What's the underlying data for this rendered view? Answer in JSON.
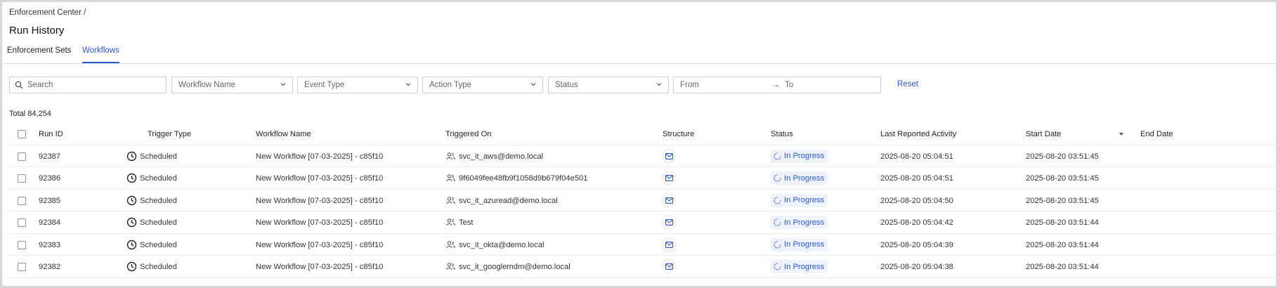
{
  "breadcrumb": "Enforcement Center /",
  "page_title": "Run History",
  "tabs": [
    {
      "label": "Enforcement Sets",
      "active": false
    },
    {
      "label": "Workflows",
      "active": true
    }
  ],
  "filters": {
    "search_placeholder": "Search",
    "workflow_name": "Workflow Name",
    "event_type": "Event Type",
    "action_type": "Action Type",
    "status": "Status",
    "from": "From",
    "to": "To",
    "reset": "Reset"
  },
  "total": "Total 84,254",
  "columns": [
    "Run ID",
    "Trigger Type",
    "Workflow Name",
    "Triggered On",
    "Structure",
    "Status",
    "Last Reported Activity",
    "Start Date",
    "End Date"
  ],
  "rows": [
    {
      "run_id": "92387",
      "trigger": "Scheduled",
      "workflow": "New Workflow [07-03-2025] - c85f10",
      "triggered_on": "svc_it_aws@demo.local",
      "status": "In Progress",
      "last_activity": "2025-08-20 05:04:51",
      "start_date": "2025-08-20 03:51:45",
      "end_date": ""
    },
    {
      "run_id": "92386",
      "trigger": "Scheduled",
      "workflow": "New Workflow [07-03-2025] - c85f10",
      "triggered_on": "9f6049fee48fb9f1058d9b679f04e501",
      "status": "In Progress",
      "last_activity": "2025-08-20 05:04:51",
      "start_date": "2025-08-20 03:51:45",
      "end_date": ""
    },
    {
      "run_id": "92385",
      "trigger": "Scheduled",
      "workflow": "New Workflow [07-03-2025] - c85f10",
      "triggered_on": "svc_it_azuread@demo.local",
      "status": "In Progress",
      "last_activity": "2025-08-20 05:04:50",
      "start_date": "2025-08-20 03:51:45",
      "end_date": ""
    },
    {
      "run_id": "92384",
      "trigger": "Scheduled",
      "workflow": "New Workflow [07-03-2025] - c85f10",
      "triggered_on": "Test",
      "status": "In Progress",
      "last_activity": "2025-08-20 05:04:42",
      "start_date": "2025-08-20 03:51:44",
      "end_date": ""
    },
    {
      "run_id": "92383",
      "trigger": "Scheduled",
      "workflow": "New Workflow [07-03-2025] - c85f10",
      "triggered_on": "svc_it_okta@demo.local",
      "status": "In Progress",
      "last_activity": "2025-08-20 05:04:39",
      "start_date": "2025-08-20 03:51:44",
      "end_date": ""
    },
    {
      "run_id": "92382",
      "trigger": "Scheduled",
      "workflow": "New Workflow [07-03-2025] - c85f10",
      "triggered_on": "svc_it_googlemdm@demo.local",
      "status": "In Progress",
      "last_activity": "2025-08-20 05:04:38",
      "start_date": "2025-08-20 03:51:44",
      "end_date": ""
    }
  ],
  "icons": {
    "search": "search-icon",
    "dropdown": "chevron-down-icon",
    "trigger": "clock-icon",
    "entity": "users-icon",
    "structure": "mail-icon",
    "status": "spinner-icon",
    "sort": "sort-desc-icon"
  },
  "colors": {
    "accent": "#2a57c7",
    "status_bg": "#eef2fb",
    "border": "#c9cdd3"
  }
}
